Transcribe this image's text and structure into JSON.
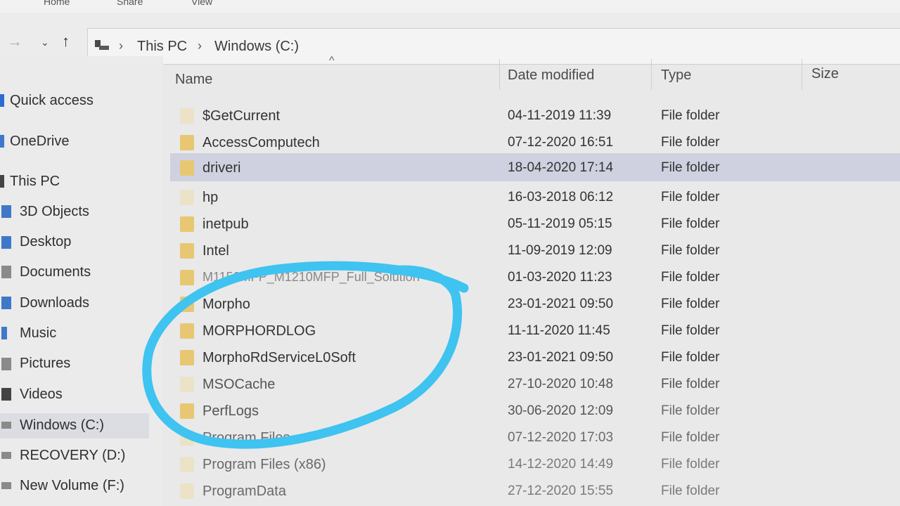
{
  "ribbon": {
    "tabs": [
      "Home",
      "Share",
      "View"
    ]
  },
  "address": {
    "crumbs": [
      "This PC",
      "Windows (C:)"
    ]
  },
  "sidebar": {
    "items": [
      {
        "label": "Quick access"
      },
      {
        "label": "OneDrive"
      },
      {
        "label": "This PC"
      },
      {
        "label": "3D Objects"
      },
      {
        "label": "Desktop"
      },
      {
        "label": "Documents"
      },
      {
        "label": "Downloads"
      },
      {
        "label": "Music"
      },
      {
        "label": "Pictures"
      },
      {
        "label": "Videos"
      },
      {
        "label": "Windows (C:)"
      },
      {
        "label": "RECOVERY (D:)"
      },
      {
        "label": "New Volume (F:)"
      }
    ]
  },
  "columns": {
    "name": "Name",
    "date": "Date modified",
    "type": "Type",
    "size": "Size"
  },
  "files": [
    {
      "name": "$GetCurrent",
      "date": "04-11-2019 11:39",
      "type": "File folder"
    },
    {
      "name": "AccessComputech",
      "date": "07-12-2020 16:51",
      "type": "File folder"
    },
    {
      "name": "driveri",
      "date": "18-04-2020 17:14",
      "type": "File folder"
    },
    {
      "name": "hp",
      "date": "16-03-2018 06:12",
      "type": "File folder"
    },
    {
      "name": "inetpub",
      "date": "05-11-2019 05:15",
      "type": "File folder"
    },
    {
      "name": "Intel",
      "date": "11-09-2019 12:09",
      "type": "File folder"
    },
    {
      "name": "M1150MFP_M1210MFP_Full_Solution",
      "date": "01-03-2020 11:23",
      "type": "File folder"
    },
    {
      "name": "Morpho",
      "date": "23-01-2021 09:50",
      "type": "File folder"
    },
    {
      "name": "MORPHORDLOG",
      "date": "11-11-2020 11:45",
      "type": "File folder"
    },
    {
      "name": "MorphoRdServiceL0Soft",
      "date": "23-01-2021 09:50",
      "type": "File folder"
    },
    {
      "name": "MSOCache",
      "date": "27-10-2020 10:48",
      "type": "File folder"
    },
    {
      "name": "PerfLogs",
      "date": "30-06-2020 12:09",
      "type": "File folder"
    },
    {
      "name": "Program Files",
      "date": "07-12-2020 17:03",
      "type": "File folder"
    },
    {
      "name": "Program Files (x86)",
      "date": "14-12-2020 14:49",
      "type": "File folder"
    },
    {
      "name": "ProgramData",
      "date": "27-12-2020 15:55",
      "type": "File folder"
    }
  ],
  "colors": {
    "selection": "#cfd1e0",
    "folder": "#e8c773",
    "annotation": "#3fc3f0"
  }
}
